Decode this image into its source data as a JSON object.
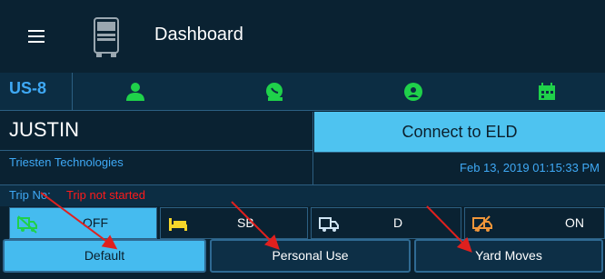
{
  "header": {
    "title": "Dashboard",
    "menu_icon": "hamburger-icon",
    "logo_icon": "truck-icon"
  },
  "status_row": {
    "cycle": "US-8",
    "icons": [
      "driver-icon",
      "co-driver-icon",
      "support-icon",
      "calendar-icon"
    ],
    "icon_color": "#1fd14a"
  },
  "driver": {
    "name": "JUSTIN",
    "company": "Triesten Technologies",
    "connect_label": "Connect to ELD",
    "datetime": "Feb 13, 2019 01:15:33 PM"
  },
  "trip": {
    "label": "Trip No:",
    "value": "Trip not started",
    "value_color": "#ff1a1a"
  },
  "duty_status": [
    {
      "label": "OFF",
      "icon": "truck-off-icon",
      "active": true
    },
    {
      "label": "SB",
      "icon": "bed-icon",
      "active": false
    },
    {
      "label": "D",
      "icon": "truck-driving-icon",
      "active": false
    },
    {
      "label": "ON",
      "icon": "truck-on-duty-icon",
      "active": false
    }
  ],
  "modes": [
    {
      "label": "Default",
      "active": true
    },
    {
      "label": "Personal Use",
      "active": false
    },
    {
      "label": "Yard Moves",
      "active": false
    }
  ],
  "colors": {
    "accent": "#45bbef",
    "background": "#0a2232",
    "annotation_arrow": "#e0201e"
  }
}
